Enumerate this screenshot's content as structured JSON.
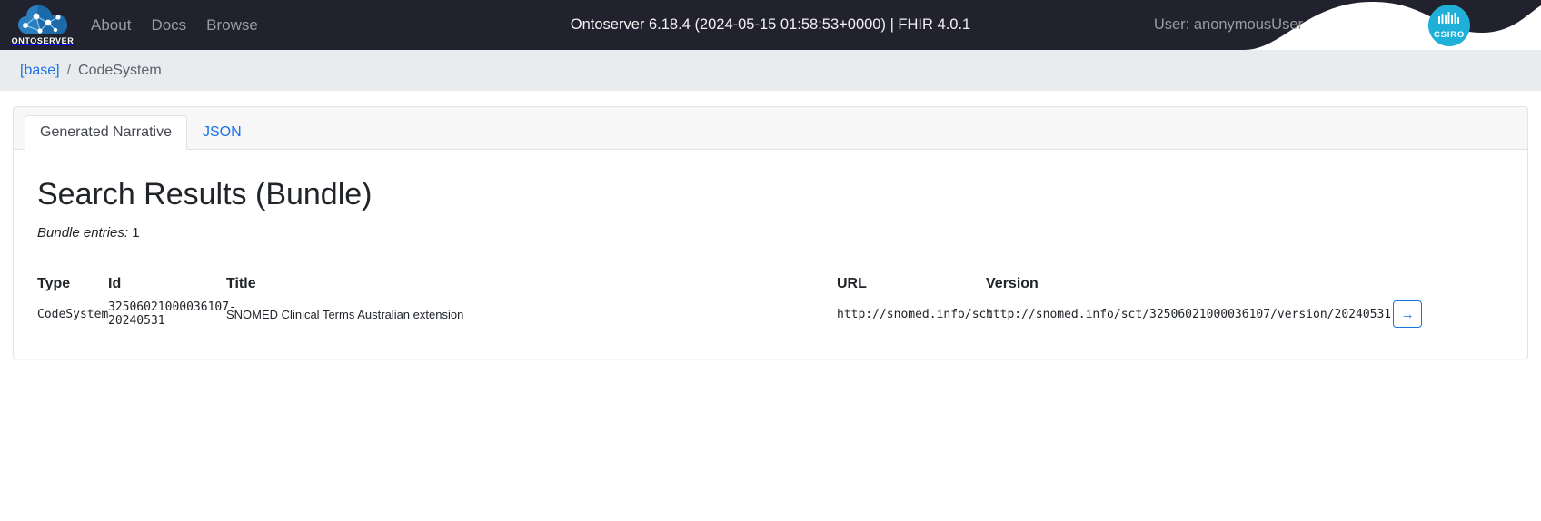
{
  "navbar": {
    "brand_word": "ONTOSERVER",
    "brand_icon": "ontoserver-cloud-logo",
    "links": [
      {
        "label": "About"
      },
      {
        "label": "Docs"
      },
      {
        "label": "Browse"
      }
    ],
    "center_text": "Ontoserver 6.18.4 (2024-05-15 01:58:53+0000) | FHIR 4.0.1",
    "user_text": "User: anonymousUser",
    "csiro_word": "CSIRO",
    "csiro_icon": "csiro-logo",
    "colors": {
      "background": "#22222e",
      "link": "#9a9aa6",
      "center_text": "#f2f2f4",
      "csiro_circle": "#1eb0d8"
    }
  },
  "breadcrumb": {
    "base_label": "[base]",
    "separator": "/",
    "current_label": "CodeSystem",
    "link_color": "#1a73e8",
    "background": "#e9ecef"
  },
  "card": {
    "tabs": [
      {
        "label": "Generated Narrative",
        "active": true
      },
      {
        "label": "JSON",
        "active": false
      }
    ],
    "title": "Search Results (Bundle)",
    "entries_label": "Bundle entries:",
    "entries_count": "1",
    "table": {
      "headers": [
        "Type",
        "Id",
        "Title",
        "URL",
        "Version"
      ],
      "rows": [
        {
          "type": "CodeSystem",
          "id": "32506021000036107-20240531",
          "title": "SNOMED Clinical Terms Australian extension",
          "url": "http://snomed.info/sct",
          "version": "http://snomed.info/sct/32506021000036107/version/20240531",
          "action_icon": "arrow-right-icon",
          "action_glyph": "→"
        }
      ]
    }
  }
}
